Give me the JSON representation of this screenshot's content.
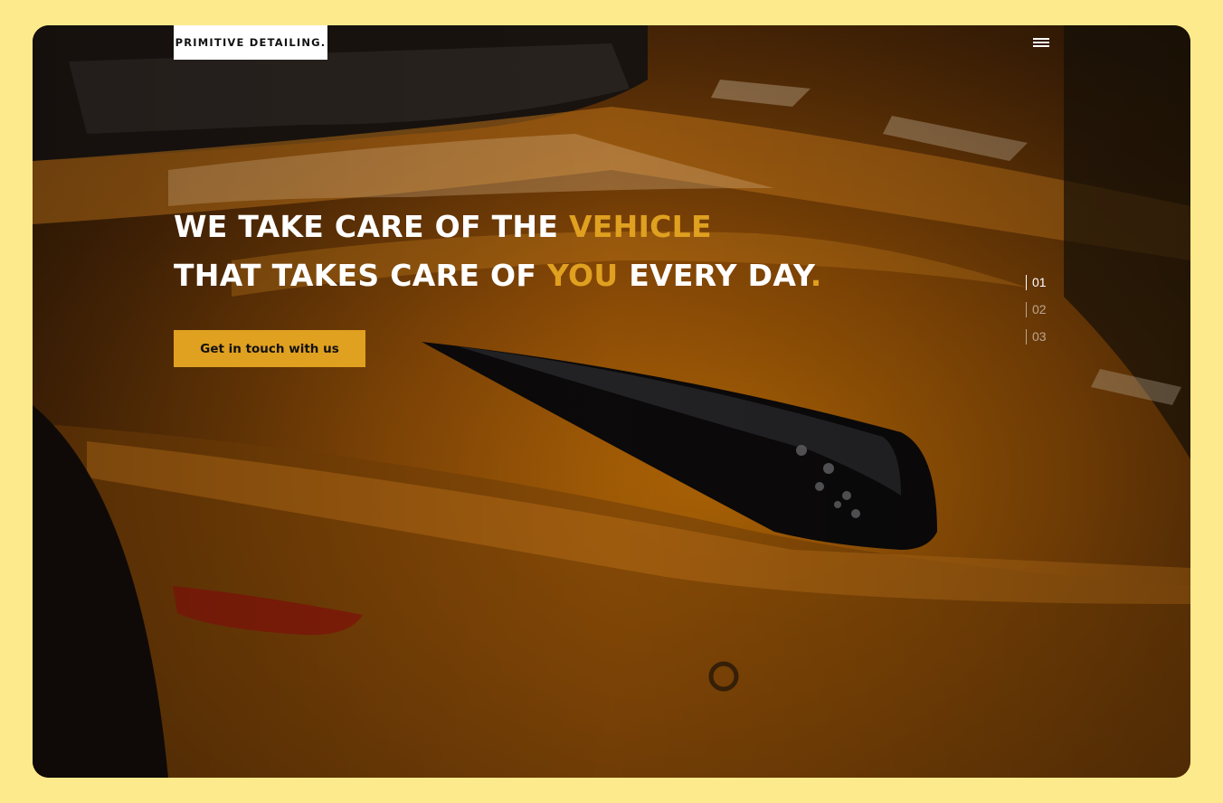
{
  "brand": {
    "logo_text": "PRIMITIVE DETAILING."
  },
  "header": {
    "menu_icon": "hamburger-menu-icon"
  },
  "hero": {
    "headline_line1_pre": "WE TAKE CARE OF THE ",
    "headline_line1_accent": "VEHICLE",
    "headline_line2_pre": "THAT TAKES CARE OF ",
    "headline_line2_accent": "YOU",
    "headline_line2_post": " EVERY DAY",
    "headline_period": ".",
    "cta_label": "Get in touch with us",
    "image": "orange-sports-car-headlight"
  },
  "slider": {
    "pages": [
      "01",
      "02",
      "03"
    ],
    "active_index": 0
  },
  "colors": {
    "page_background": "#fdea8c",
    "accent": "#e0a020",
    "text": "#ffffff"
  }
}
